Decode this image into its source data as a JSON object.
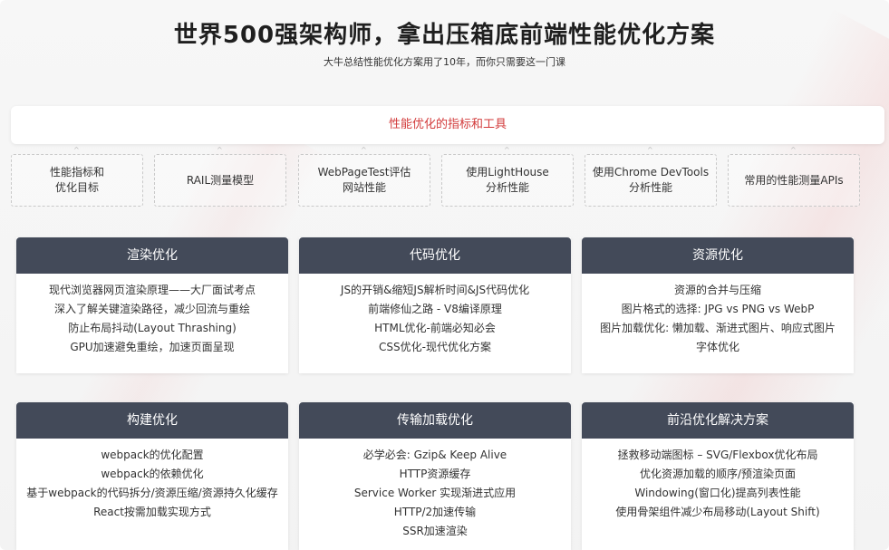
{
  "title": "世界500强架构师，拿出压箱底前端性能优化方案",
  "subtitle": "大牛总结性能优化方案用了10年，而你只需要这一门课",
  "tools_header": "性能优化的指标和工具",
  "tools": [
    {
      "line1": "性能指标和",
      "line2": "优化目标"
    },
    {
      "line1": "RAIL测量模型",
      "line2": ""
    },
    {
      "line1": "WebPageTest评估",
      "line2": "网站性能"
    },
    {
      "line1": "使用LightHouse",
      "line2": "分析性能"
    },
    {
      "line1": "使用Chrome DevTools",
      "line2": "分析性能"
    },
    {
      "line1": "常用的性能测量APIs",
      "line2": ""
    }
  ],
  "cards": [
    {
      "title": "渲染优化",
      "items": [
        "现代浏览器网页渲染原理——大厂面试考点",
        "深入了解关键渲染路径，减少回流与重绘",
        "防止布局抖动(Layout Thrashing)",
        "GPU加速避免重绘，加速页面呈现"
      ]
    },
    {
      "title": "代码优化",
      "items": [
        "JS的开销&缩短JS解析时间&JS代码优化",
        "前端修仙之路 - V8编译原理",
        "HTML优化-前端必知必会",
        "CSS优化-现代优化方案"
      ]
    },
    {
      "title": "资源优化",
      "items": [
        "资源的合并与压缩",
        "图片格式的选择: JPG vs PNG vs WebP",
        "图片加载优化: 懒加载、渐进式图片、响应式图片",
        "字体优化"
      ]
    },
    {
      "title": "构建优化",
      "items": [
        "webpack的优化配置",
        "webpack的依赖优化",
        "基于webpack的代码拆分/资源压缩/资源持久化缓存",
        "React按需加载实现方式"
      ]
    },
    {
      "title": "传输加载优化",
      "items": [
        "必学必会: Gzip& Keep Alive",
        "HTTP资源缓存",
        "Service Worker 实现渐进式应用",
        "HTTP/2加速传输",
        "SSR加速渲染"
      ]
    },
    {
      "title": "前沿优化解决方案",
      "items": [
        "拯救移动端图标 – SVG/Flexbox优化布局",
        "优化资源加载的顺序/预渲染页面",
        "Windowing(窗口化)提高列表性能",
        "使用骨架组件减少布局移动(Layout Shift)"
      ]
    }
  ],
  "colors": {
    "accent": "#d23a3a",
    "card_header": "#434a59"
  }
}
